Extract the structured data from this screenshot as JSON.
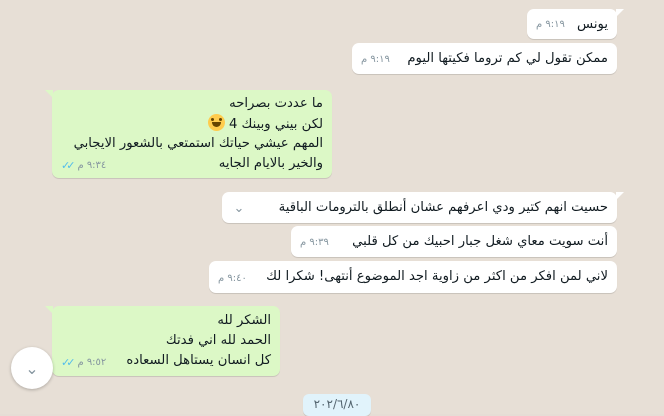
{
  "messages": [
    {
      "direction": "in",
      "lines": [
        "يونس"
      ],
      "time": "٩:١٩ م"
    },
    {
      "direction": "in",
      "lines": [
        "ممكن تقول لي كم تروما فكيتها اليوم"
      ],
      "time": "٩:١٩ م"
    },
    {
      "direction": "out",
      "lines": [
        "ما عددت بصراحه",
        "لكن بيني وبينك 4",
        "المهم عيشي حياتك استمتعي بالشعور الايجابي",
        "والخير بالايام الجايه"
      ],
      "time": "٩:٣٤ م",
      "status_icon": "double-check-icon"
    },
    {
      "direction": "in",
      "lines": [
        "حسيت انهم كتير ودي اعرفهم عشان أنطلق بالترومات الباقية"
      ],
      "time": ""
    },
    {
      "direction": "in",
      "lines": [
        "أنت سويت معاي شغل جبار احبيك من كل قلبي"
      ],
      "time": "٩:٣٩ م"
    },
    {
      "direction": "in",
      "lines": [
        "لاني لمن افكر من اكثر من زاوية اجد الموضوع أنتهى! شكرا لك"
      ],
      "time": "٩:٤٠ م"
    },
    {
      "direction": "out",
      "lines": [
        "الشكر لله",
        "الحمد لله اني فدتك",
        "كل انسان يستاهل السعاده"
      ],
      "time": "٩:٥٢ م",
      "status_icon": "double-check-icon"
    }
  ],
  "date_chip": "٢٠٢/٦/٨٠",
  "icons": {
    "scroll_down": "chevron-down-icon",
    "message_menu": "chevron-down-icon"
  },
  "colors": {
    "incoming": "#ffffff",
    "outgoing": "#dcf8c6",
    "background": "#e7dfd6",
    "ticks": "#53bdeb"
  }
}
